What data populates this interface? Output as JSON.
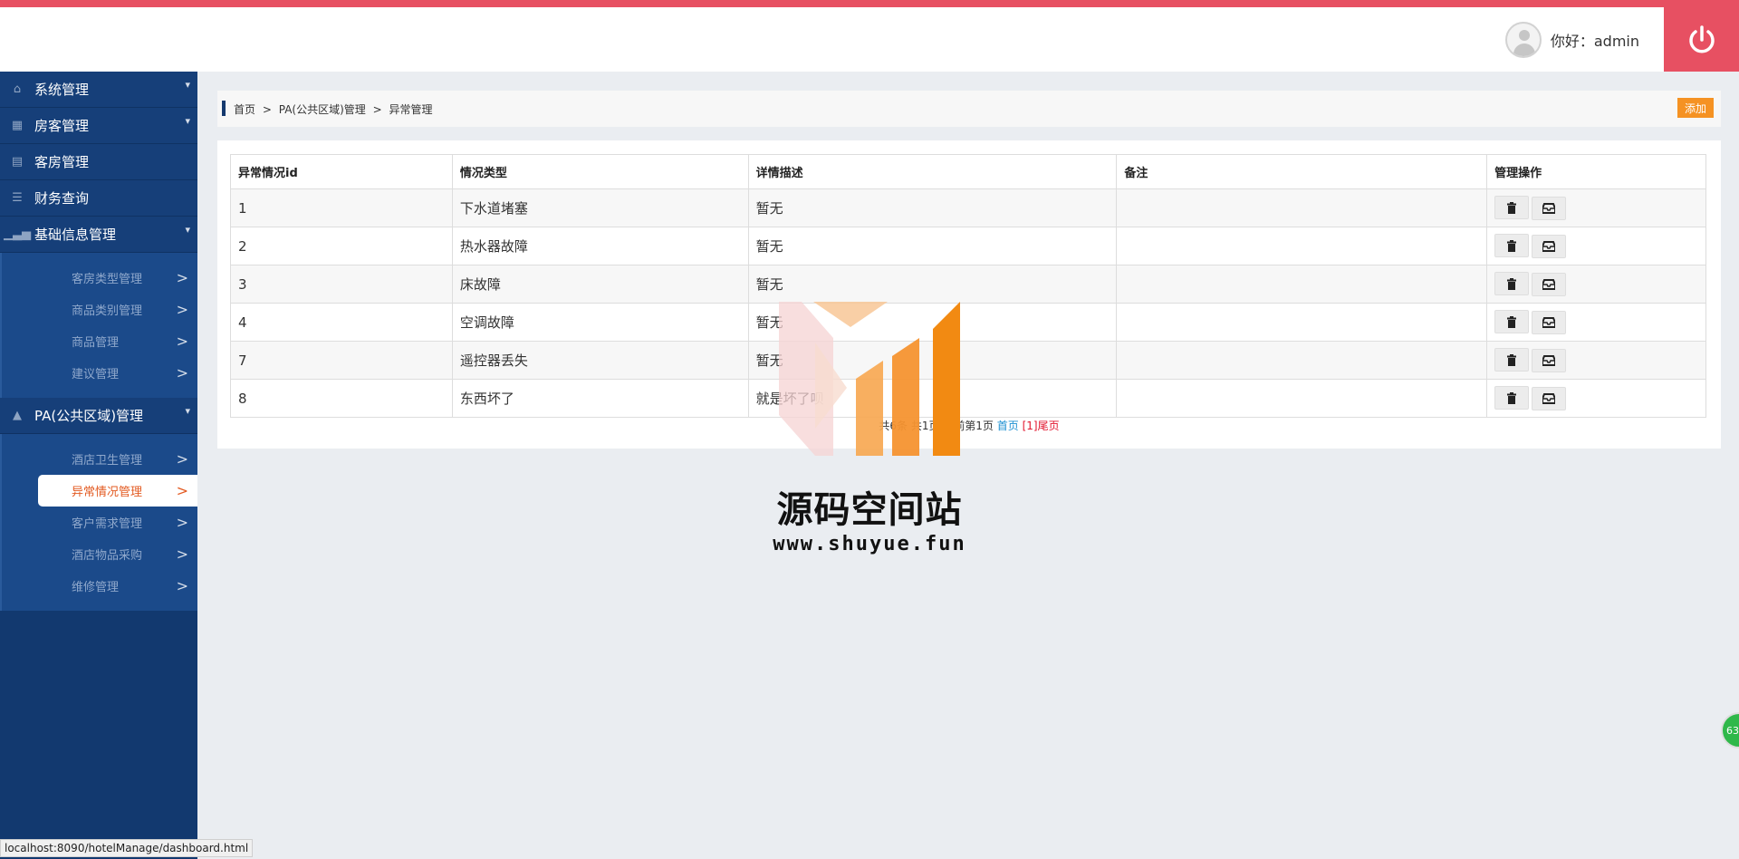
{
  "header": {
    "greeting": "你好：admin"
  },
  "sidebar": {
    "menus": [
      {
        "label": "系统管理",
        "icon": "home-icon",
        "expandable": true
      },
      {
        "label": "房客管理",
        "icon": "grid-icon",
        "expandable": true
      },
      {
        "label": "客房管理",
        "icon": "calendar-icon",
        "expandable": false
      },
      {
        "label": "财务查询",
        "icon": "list-icon",
        "expandable": false
      },
      {
        "label": "基础信息管理",
        "icon": "signal-icon",
        "expandable": true
      }
    ],
    "basic_submenu": [
      "客房类型管理",
      "商品类别管理",
      "商品管理",
      "建议管理"
    ],
    "pa_menu": {
      "label": "PA(公共区域)管理",
      "icon": "warning-icon"
    },
    "pa_submenu": [
      "酒店卫生管理",
      "异常情况管理",
      "客户需求管理",
      "酒店物品采购",
      "维修管理"
    ],
    "active_item": "异常情况管理"
  },
  "breadcrumb": {
    "items": [
      "首页",
      "PA(公共区域)管理",
      "异常管理"
    ],
    "separator": ">",
    "add_label": "添加"
  },
  "table": {
    "headers": [
      "异常情况id",
      "情况类型",
      "详情描述",
      "备注",
      "管理操作"
    ],
    "rows": [
      {
        "id": "1",
        "type": "下水道堵塞",
        "desc": "暂无",
        "note": ""
      },
      {
        "id": "2",
        "type": "热水器故障",
        "desc": "暂无",
        "note": ""
      },
      {
        "id": "3",
        "type": "床故障",
        "desc": "暂无",
        "note": ""
      },
      {
        "id": "4",
        "type": "空调故障",
        "desc": "暂无",
        "note": ""
      },
      {
        "id": "7",
        "type": "遥控器丢失",
        "desc": "暂无",
        "note": ""
      },
      {
        "id": "8",
        "type": "东西坏了",
        "desc": "就是坏了呗",
        "note": ""
      }
    ]
  },
  "pager": {
    "summary": "共6条 共1页 当前第1页",
    "first": "首页",
    "current": "[1]",
    "last": "尾页"
  },
  "watermark": {
    "title": "源码空间站",
    "url": "www.shuyue.fun"
  },
  "badge": "63",
  "status_url": "localhost:8090/hotelManage/dashboard.html",
  "colors": {
    "accent": "#e75062",
    "sidebar": "#12396f",
    "active_text": "#e35b22",
    "add_button": "#f59223"
  }
}
